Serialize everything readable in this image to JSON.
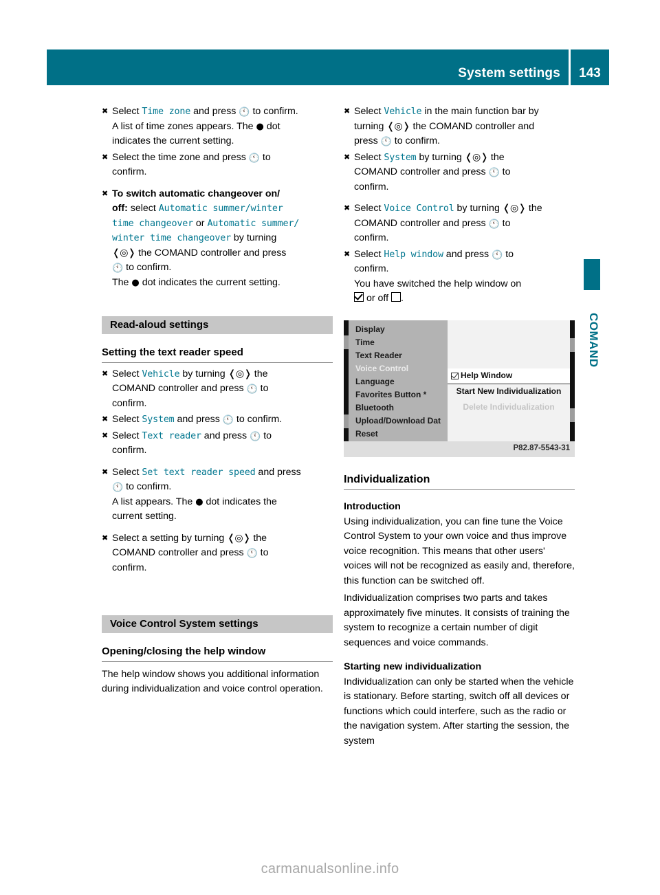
{
  "header": {
    "title": "System settings",
    "page_number": "143",
    "accent_color": "#007087"
  },
  "edge_tab": {
    "label": "COMAND"
  },
  "left_column": {
    "steps": [
      {
        "marker": "X",
        "lines": [
          "Select | Time zone | and press | (press) | to confirm.",
          "A list of time zones appears. The | (dot) | dot",
          "indicates the current setting."
        ]
      }
    ],
    "step1_text_a": "Select ",
    "step1_cmd": "Time zone",
    "step1_text_b": " and press ",
    "step1_text_c": " to confirm.",
    "step1_line2": "A list of time zones appears. The",
    "step1_line2b": "dot",
    "step1_line3": "indicates the current setting.",
    "step2_text_a": "Select the time zone and press ",
    "step2_text_b": " to",
    "step2_line2": "confirm.",
    "step3_bold": "To switch automatic changeover on/",
    "step3_bold2": "off:",
    "step3_text_a": " select ",
    "step3_cmd1": "Automatic summer/winter",
    "step3_cmd1b": "time changeover",
    "step3_or": " or ",
    "step3_cmd2": "Automatic summer/",
    "step3_cmd2b": "winter time changeover",
    "step3_text_b": " by turning",
    "step3_text_c": " the COMAND controller and press",
    "step3_text_d": " to confirm.",
    "step3_line_last_a": "The",
    "step3_line_last_b": "dot indicates the current setting.",
    "banner_readaloud": "Read-aloud settings",
    "heading_text_reader_speed": "Setting the text reader speed",
    "ra_step1_a": "Select ",
    "ra_step1_cmd": "Vehicle",
    "ra_step1_b": " by turning ",
    "ra_step1_c": " the",
    "ra_step1_line2": "COMAND controller and press ",
    "ra_step1_line2b": " to",
    "ra_step1_line3": "confirm.",
    "ra_step2_a": "Select ",
    "ra_step2_cmd": "System",
    "ra_step2_b": " and press ",
    "ra_step2_c": " to confirm.",
    "ra_step3_a": "Select ",
    "ra_step3_cmd": "Text reader",
    "ra_step3_b": " and press ",
    "ra_step3_c": " to",
    "ra_step3_line2": "confirm.",
    "ra_step4_a": "Select ",
    "ra_step4_cmd": "Set text reader speed",
    "ra_step4_b": " and press",
    "ra_step4_line2": " to confirm.",
    "ra_step4_line3a": "A list appears. The",
    "ra_step4_line3b": "dot indicates the",
    "ra_step4_line4": "current setting.",
    "ra_step5_a": "Select a setting by turning ",
    "ra_step5_b": " the",
    "ra_step5_line2": "COMAND controller and press ",
    "ra_step5_line2b": " to",
    "ra_step5_line3": "confirm.",
    "banner_voice_control": "Voice Control System settings",
    "heading_help_window": "Opening/closing the help window",
    "help_window_para": "The help window shows you additional information during individualization and voice control operation."
  },
  "right_column": {
    "rc_step1_a": "Select ",
    "rc_step1_cmd": "Vehicle",
    "rc_step1_b": " in the main function bar by",
    "rc_step1_line2a": "turning ",
    "rc_step1_line2b": " the COMAND controller and",
    "rc_step1_line3a": "press ",
    "rc_step1_line3b": " to confirm.",
    "rc_step2_a": "Select ",
    "rc_step2_cmd": "System",
    "rc_step2_b": " by turning ",
    "rc_step2_c": " the",
    "rc_step2_line2a": "COMAND controller and press ",
    "rc_step2_line2b": " to",
    "rc_step2_line3": "confirm.",
    "rc_step3_a": "Select ",
    "rc_step3_cmd": "Voice Control",
    "rc_step3_b": " by turning ",
    "rc_step3_c": " the",
    "rc_step3_line2a": "COMAND controller and press ",
    "rc_step3_line2b": " to",
    "rc_step3_line3": "confirm.",
    "rc_step4_a": "Select ",
    "rc_step4_cmd": "Help window",
    "rc_step4_b": " and press ",
    "rc_step4_c": " to",
    "rc_step4_line2": "confirm.",
    "rc_step4_line3": "You have switched the help window on",
    "rc_step4_line4a": " or off ",
    "rc_step4_line4b": ".",
    "heading_individualization": "Individualization",
    "heading_introduction": "Introduction",
    "intro_para1": "Using individualization, you can fine tune the Voice Control System to your own voice and thus improve voice recognition. This means that other users' voices will not be recognized as easily and, therefore, this function can be switched off.",
    "intro_para2": "Individualization comprises two parts and takes approximately five minutes. It consists of training the system to recognize a certain number of digit sequences and voice commands.",
    "heading_starting_new": "Starting new individualization",
    "starting_para": "Individualization can only be started when the vehicle is stationary. Before starting, switch off all devices or functions which could interfere, such as the radio or the navigation system. After starting the session, the system"
  },
  "comand_screen": {
    "menu_items": [
      {
        "label": "Display",
        "state": "normal"
      },
      {
        "label": "Time",
        "state": "normal"
      },
      {
        "label": "Text Reader",
        "state": "normal"
      },
      {
        "label": "Voice Control",
        "state": "highlighted"
      },
      {
        "label": "Language",
        "state": "normal"
      },
      {
        "label": "Favorites Button *",
        "state": "normal"
      },
      {
        "label": "Bluetooth",
        "state": "normal"
      },
      {
        "label": "Upload/Download Dat",
        "state": "normal"
      },
      {
        "label": "Reset",
        "state": "normal"
      }
    ],
    "help_window_label": "Help Window",
    "start_new_label": "Start New Individualization",
    "delete_label": "Delete Individualization",
    "caption": "P82.87-5543-31"
  },
  "footer": {
    "watermark": "carmanualsonline.info"
  }
}
